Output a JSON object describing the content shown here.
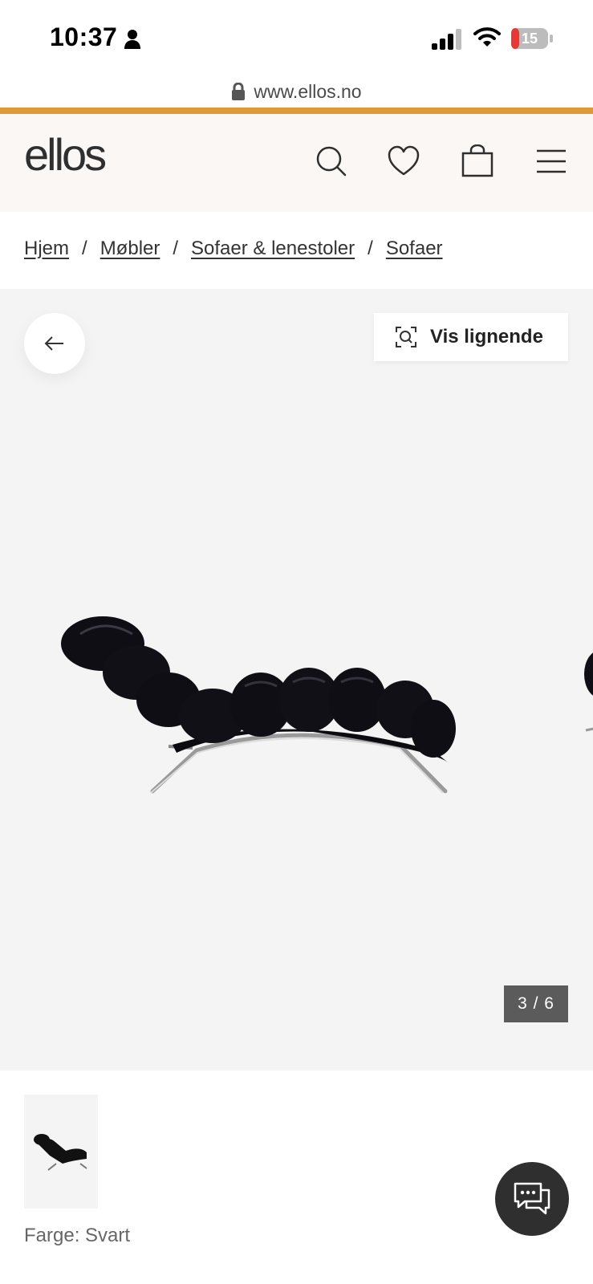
{
  "status_bar": {
    "time": "10:37",
    "battery": "15",
    "icons": [
      "person-icon",
      "signal-icon",
      "wifi-icon",
      "battery-icon"
    ]
  },
  "browser": {
    "url": "www.ellos.no"
  },
  "header": {
    "logo": "ellos",
    "icons": [
      "search-icon",
      "heart-icon",
      "bag-icon",
      "menu-icon"
    ],
    "accent_color": "#df9a37",
    "background_color": "#faf7f4"
  },
  "breadcrumb": {
    "items": [
      "Hjem",
      "Møbler",
      "Sofaer & lenestoler",
      "Sofaer"
    ],
    "separator": "/"
  },
  "gallery": {
    "similar_label": "Vis lignende",
    "counter": "3 / 6",
    "background_color": "#f4f4f4"
  },
  "product": {
    "color_label": "Farge: Svart"
  }
}
